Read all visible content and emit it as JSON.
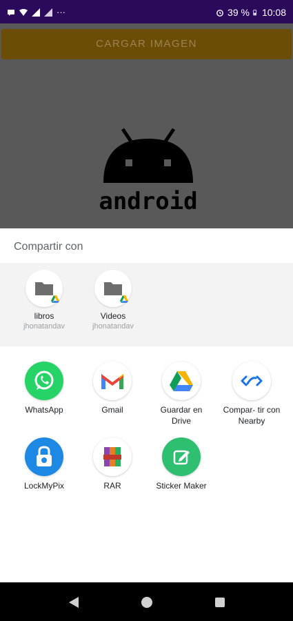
{
  "status_bar": {
    "battery": "39 %",
    "time": "10:08",
    "overflow": "···"
  },
  "app": {
    "load_button_label": "CARGAR IMAGEN",
    "image_caption": "android"
  },
  "share_sheet": {
    "title": "Compartir con",
    "direct_targets": [
      {
        "label": "libros",
        "sub": "jhonatandav"
      },
      {
        "label": "Videos",
        "sub": "jhonatandav"
      }
    ],
    "apps": [
      {
        "label": "WhatsApp"
      },
      {
        "label": "Gmail"
      },
      {
        "label": "Guardar en Drive"
      },
      {
        "label": "Compar- tir con Nearby"
      },
      {
        "label": "LockMyPix"
      },
      {
        "label": "RAR"
      },
      {
        "label": "Sticker Maker"
      }
    ]
  },
  "colors": {
    "status_bar": "#2b0a5c",
    "whatsapp": "#25d366",
    "drive_blue": "#4285f4",
    "drive_green": "#0f9d58",
    "drive_yellow": "#f4b400",
    "gmail_red": "#ea4335",
    "nearby_blue": "#1a73e8",
    "sticker_green": "#2fbf71"
  },
  "icons": {
    "nav": [
      "back-icon",
      "home-icon",
      "recents-icon"
    ]
  }
}
